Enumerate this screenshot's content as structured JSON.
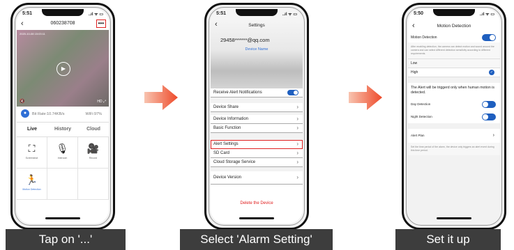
{
  "colors": {
    "accent": "#2f6fd6",
    "highlight": "#e02020",
    "caption_bg": "#3d3d3d",
    "arrow": "#ee5a3a"
  },
  "screen1": {
    "status_time": "5:51",
    "status_icons": "..ıl ᯤ ▭",
    "nav": {
      "back_icon": "chevron-left-icon",
      "back_glyph": "‹",
      "title": "060238708",
      "more_label": "•••"
    },
    "video": {
      "timestamp": "2020-10-08 15:03:11",
      "play_glyph": "▶",
      "mute_glyph": "🔇",
      "hd_label": "HD ⤢"
    },
    "bitrate": "Bit Rate:10.74KB/s",
    "wifi": "WiFi:97%",
    "tabs": [
      {
        "label": "Live"
      },
      {
        "label": "History"
      },
      {
        "label": "Cloud"
      }
    ],
    "tools": [
      {
        "label": "Screenshot",
        "icon": "screenshot-icon",
        "glyph": "⛶"
      },
      {
        "label": "Intercom",
        "icon": "microphone-icon",
        "glyph": "🎙"
      },
      {
        "label": "Record",
        "icon": "video-record-icon",
        "glyph": "🎥"
      },
      {
        "label": "Motion Detection",
        "icon": "motion-detection-icon",
        "glyph": "🏃"
      }
    ]
  },
  "screen2": {
    "status_time": "5:51",
    "title": "Settings",
    "email": "29458******@qq.com",
    "device_name": "Device Name",
    "rows": [
      {
        "label": "Receive Alert Notifications"
      },
      {
        "label": "Device Share"
      },
      {
        "label": "Device Information"
      },
      {
        "label": "Basic Function"
      },
      {
        "label": "Alert Settings"
      },
      {
        "label": "SD Card"
      },
      {
        "label": "Cloud Storage Service"
      },
      {
        "label": "Device Version"
      }
    ],
    "delete_label": "Delete the Device"
  },
  "screen3": {
    "status_time": "5:50",
    "title": "Motion Detection",
    "motion_label": "Motion Detection",
    "motion_desc": "After enabling detection, the camera can detect motion and sound around the camera and can select different detection sensitivity according to different requirements.",
    "low_label": "Low",
    "high_label": "High",
    "trigger_text": "The Alert will be triggerd only when human motion is detected.",
    "day_label": "Day Detection",
    "night_label": "Night Detection",
    "alert_plan_label": "Alert Plan",
    "alert_plan_desc": "Set the time period of the alarm, the device only triggers an alert event during this time period."
  },
  "captions": [
    "Tap on '...'",
    "Select 'Alarm Setting'",
    "Set it up"
  ]
}
